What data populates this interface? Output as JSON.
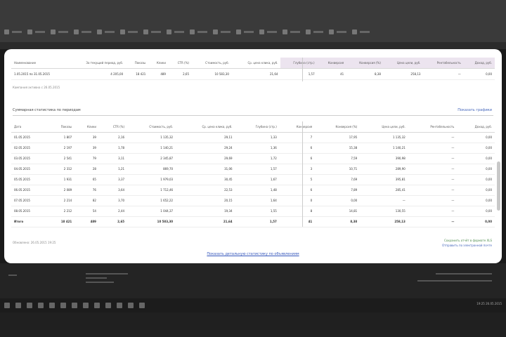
{
  "summary": {
    "headers": [
      "Наименование",
      "За текущий период, руб.",
      "Показы",
      "Клики",
      "CTR (%)",
      "Стоимость, руб.",
      "Ср. цена клика, руб.",
      "Глубина (стр.)",
      "Конверсия",
      "Конверсия (%)",
      "Цена цели, руб.",
      "Рентабельность",
      "Доход, руб."
    ],
    "row": [
      "1.05.2015 по 31.05.2015",
      "4 205,00",
      "18 421",
      "489",
      "2,65",
      "10 583,30",
      "21,64",
      "1,57",
      "41",
      "8,38",
      "258,13",
      "—",
      "0,00"
    ],
    "note": "Кампания активна с 26.05.2015"
  },
  "section": {
    "title": "Суммарная статистика по периодам",
    "link": "Показать графики"
  },
  "table": {
    "headers": [
      "Дата",
      "Показы",
      "Клики",
      "CTR (%)",
      "Стоимость, руб.",
      "Ср. цена клика, руб.",
      "Глубина (стр.)",
      "Конверсия",
      "Конверсия (%)",
      "Цена цели, руб.",
      "Рентабельность",
      "Доход, руб."
    ],
    "rows": [
      [
        "01.05.2015",
        "1 807",
        "39",
        "2,16",
        "1 135,32",
        "29,11",
        "1,33",
        "7",
        "17,95",
        "1 135,32",
        "—",
        "0,00"
      ],
      [
        "02.05.2015",
        "2 197",
        "39",
        "1,78",
        "1 140,21",
        "29,24",
        "1,36",
        "6",
        "15,38",
        "1 140,21",
        "—",
        "0,00"
      ],
      [
        "03.05.2015",
        "2 541",
        "79",
        "3,11",
        "2 345,87",
        "29,69",
        "1,72",
        "6",
        "7,59",
        "390,98",
        "—",
        "0,00"
      ],
      [
        "04.05.2015",
        "2 312",
        "28",
        "1,21",
        "869,70",
        "31,06",
        "1,57",
        "3",
        "10,71",
        "289,90",
        "—",
        "0,00"
      ],
      [
        "05.05.2015",
        "1 931",
        "65",
        "3,37",
        "1 979,03",
        "30,45",
        "1,67",
        "5",
        "7,69",
        "395,81",
        "—",
        "0,00"
      ],
      [
        "06.05.2015",
        "2 089",
        "76",
        "3,64",
        "1 712,46",
        "22,53",
        "1,48",
        "6",
        "7,89",
        "285,41",
        "—",
        "0,00"
      ],
      [
        "07.05.2015",
        "2 214",
        "82",
        "3,70",
        "1 652,22",
        "20,15",
        "1,64",
        "0",
        "0,00",
        "—",
        "—",
        "0,00"
      ],
      [
        "08.05.2015",
        "2 212",
        "54",
        "2,44",
        "1 044,37",
        "19,34",
        "1,55",
        "8",
        "14,81",
        "130,55",
        "—",
        "0,00"
      ],
      [
        "Итого",
        "18 421",
        "489",
        "2,65",
        "10 583,30",
        "21,64",
        "1,57",
        "41",
        "8,38",
        "258,13",
        "—",
        "0,00"
      ]
    ]
  },
  "footer": {
    "left": "Обновлено: 26.05.2015 19:25",
    "right_line1": "Сохранить отчёт в формате XLS",
    "right_line2": "Отправить по электронной почте",
    "link": "Показать детальную статистику по объявлениям"
  },
  "tray": {
    "time": "19:25",
    "date": "26.05.2015"
  }
}
